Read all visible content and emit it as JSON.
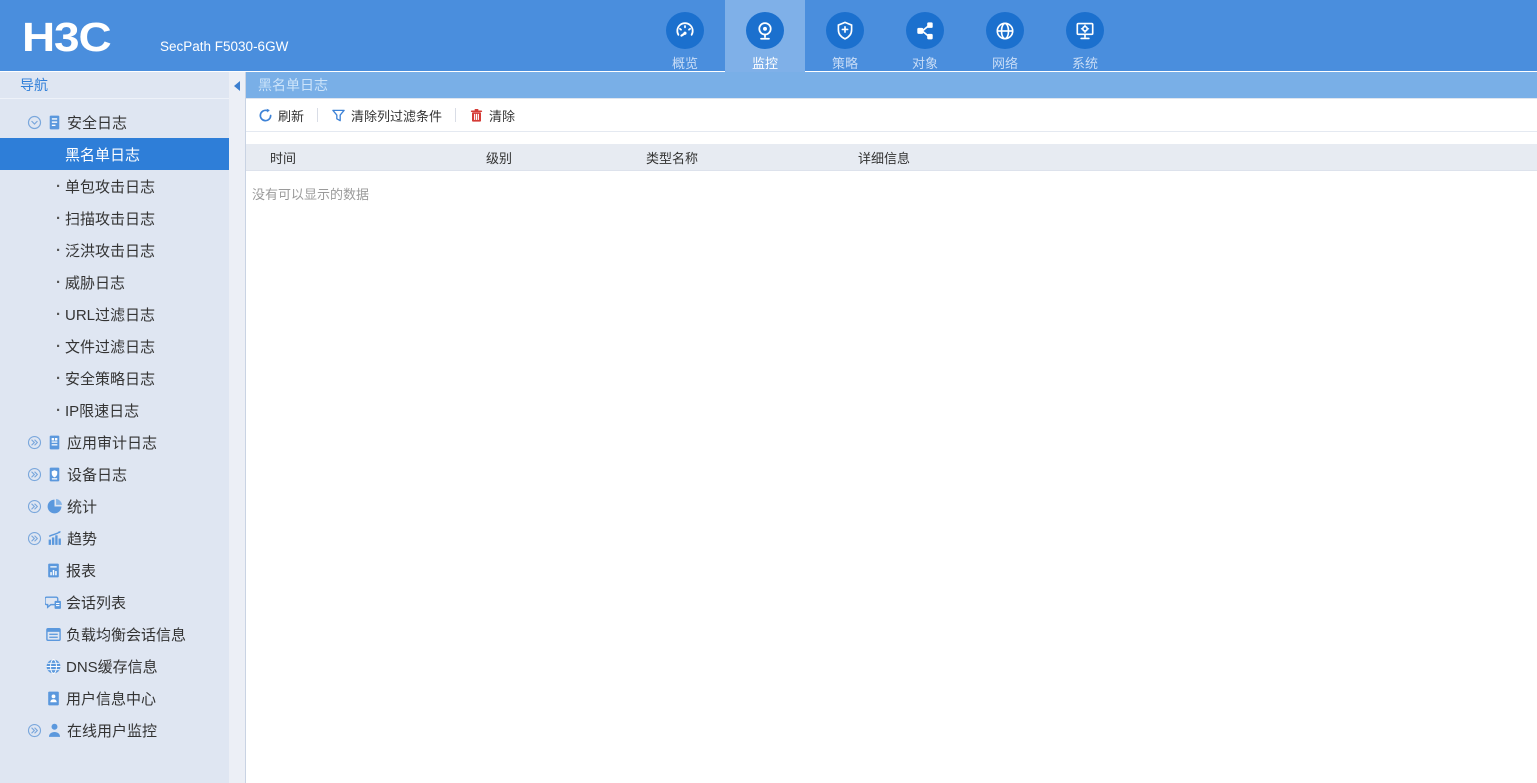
{
  "header": {
    "logo": "H3C",
    "device_model": "SecPath F5030-6GW",
    "tabs": [
      {
        "label": "概览",
        "icon": "gauge-icon",
        "active": false
      },
      {
        "label": "监控",
        "icon": "webcam-icon",
        "active": true
      },
      {
        "label": "策略",
        "icon": "shield-plus-icon",
        "active": false
      },
      {
        "label": "对象",
        "icon": "share-nodes-icon",
        "active": false
      },
      {
        "label": "网络",
        "icon": "globe-icon",
        "active": false
      },
      {
        "label": "系统",
        "icon": "system-monitor-gear-icon",
        "active": false
      }
    ]
  },
  "sidebar": {
    "title": "导航",
    "items": [
      {
        "label": "安全日志",
        "level": "top",
        "state": "expanded",
        "icon": "security-log-icon"
      },
      {
        "label": "黑名单日志",
        "level": "sub",
        "selected": true
      },
      {
        "label": "单包攻击日志",
        "level": "sub"
      },
      {
        "label": "扫描攻击日志",
        "level": "sub"
      },
      {
        "label": "泛洪攻击日志",
        "level": "sub"
      },
      {
        "label": "威胁日志",
        "level": "sub"
      },
      {
        "label": "URL过滤日志",
        "level": "sub"
      },
      {
        "label": "文件过滤日志",
        "level": "sub"
      },
      {
        "label": "安全策略日志",
        "level": "sub"
      },
      {
        "label": "IP限速日志",
        "level": "sub"
      },
      {
        "label": "应用审计日志",
        "level": "top",
        "state": "collapsed",
        "icon": "audit-log-icon"
      },
      {
        "label": "设备日志",
        "level": "top",
        "state": "collapsed",
        "icon": "device-log-icon"
      },
      {
        "label": "统计",
        "level": "top",
        "state": "collapsed",
        "icon": "pie-chart-icon"
      },
      {
        "label": "趋势",
        "level": "top",
        "state": "collapsed",
        "icon": "trend-chart-icon"
      },
      {
        "label": "报表",
        "level": "leaf",
        "icon": "report-icon"
      },
      {
        "label": "会话列表",
        "level": "leaf",
        "icon": "session-list-icon"
      },
      {
        "label": "负载均衡会话信息",
        "level": "leaf",
        "icon": "load-balance-icon"
      },
      {
        "label": "DNS缓存信息",
        "level": "leaf",
        "icon": "dns-globe-icon"
      },
      {
        "label": "用户信息中心",
        "level": "leaf",
        "icon": "user-info-icon"
      },
      {
        "label": "在线用户监控",
        "level": "top",
        "state": "collapsed",
        "icon": "online-user-icon"
      }
    ]
  },
  "main": {
    "breadcrumb": "黑名单日志",
    "toolbar": {
      "refresh": "刷新",
      "clear_filters": "清除列过滤条件",
      "clear": "清除"
    },
    "table": {
      "columns": [
        "时间",
        "级别",
        "类型名称",
        "详细信息"
      ],
      "empty_text": "没有可以显示的数据"
    }
  },
  "colors": {
    "banner_blue": "#4a8edd",
    "active_tab_blue": "#7fb0e8",
    "icon_circle_blue": "#1b70ce",
    "breadcrumb_blue": "#79afe7",
    "sidebar_bg": "#dfe6f2",
    "selected_item_blue": "#2e7ed8",
    "accent_blue": "#3d82d6",
    "danger_red": "#d53c37",
    "table_header_bg": "#e7ebf2"
  }
}
